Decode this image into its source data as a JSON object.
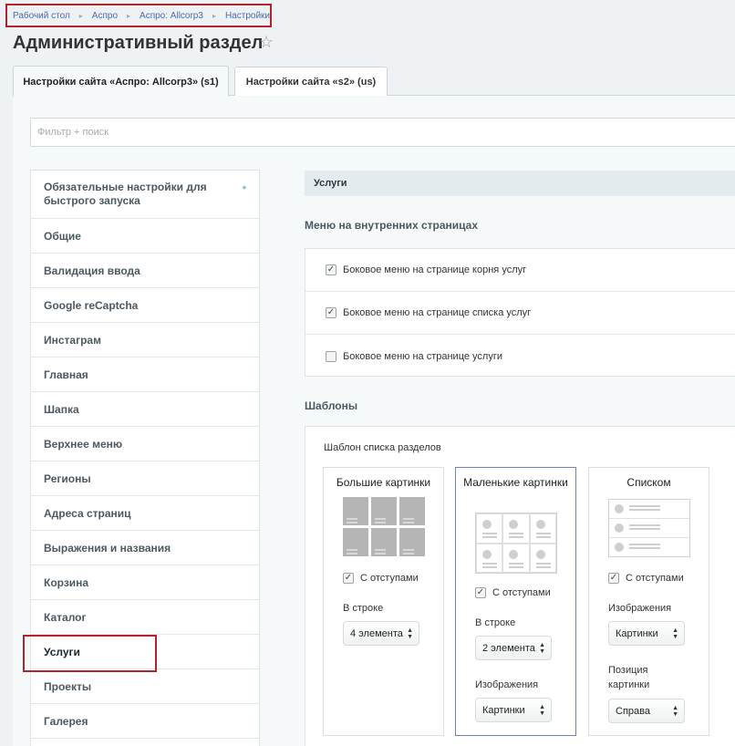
{
  "breadcrumb": [
    "Рабочий стол",
    "Аспро",
    "Аспро: Allcorp3",
    "Настройки"
  ],
  "page_title": "Административный раздел",
  "tabs": [
    {
      "label": "Настройки сайта «Аспро: Allcorp3» (s1)",
      "active": true
    },
    {
      "label": "Настройки сайта «s2» (us)",
      "active": false
    }
  ],
  "filter_placeholder": "Фильтр + поиск",
  "sidebar": {
    "items": [
      {
        "label": "Обязательные настройки для быстрого запуска",
        "required_mark": "*"
      },
      {
        "label": "Общие"
      },
      {
        "label": "Валидация ввода"
      },
      {
        "label": "Google reCaptcha"
      },
      {
        "label": "Инстаграм"
      },
      {
        "label": "Главная"
      },
      {
        "label": "Шапка"
      },
      {
        "label": "Верхнее меню"
      },
      {
        "label": "Регионы"
      },
      {
        "label": "Адреса страниц"
      },
      {
        "label": "Выражения и названия"
      },
      {
        "label": "Корзина"
      },
      {
        "label": "Каталог"
      },
      {
        "label": "Услуги",
        "selected": true
      },
      {
        "label": "Проекты"
      },
      {
        "label": "Галерея"
      }
    ]
  },
  "main": {
    "section_title": "Услуги",
    "menu_title": "Меню на внутренних страницах",
    "menu_options": [
      {
        "label": "Боковое меню на странице корня услуг",
        "checked": true
      },
      {
        "label": "Боковое меню на странице списка услуг",
        "checked": true
      },
      {
        "label": "Боковое меню на странице услуги",
        "checked": false
      }
    ],
    "templates_title": "Шаблоны",
    "templates_label": "Шаблон списка разделов",
    "cards": [
      {
        "title": "Большие картинки",
        "margins_label": "С отступами",
        "margins_checked": true,
        "row_label": "В строке",
        "row_value": "4 элемента"
      },
      {
        "title": "Маленькие картинки",
        "margins_label": "С отступами",
        "margins_checked": true,
        "row_label": "В строке",
        "row_value": "2 элемента",
        "images_label": "Изображения",
        "images_value": "Картинки"
      },
      {
        "title": "Списком",
        "margins_label": "С отступами",
        "margins_checked": true,
        "images_label": "Изображения",
        "images_value": "Картинки",
        "position_label": "Позиция картинки",
        "position_value": "Справа"
      }
    ]
  },
  "colors": {
    "highlight": "#b1242a",
    "link": "#4a6bb0",
    "selected_card_border": "#6d7fc0"
  }
}
